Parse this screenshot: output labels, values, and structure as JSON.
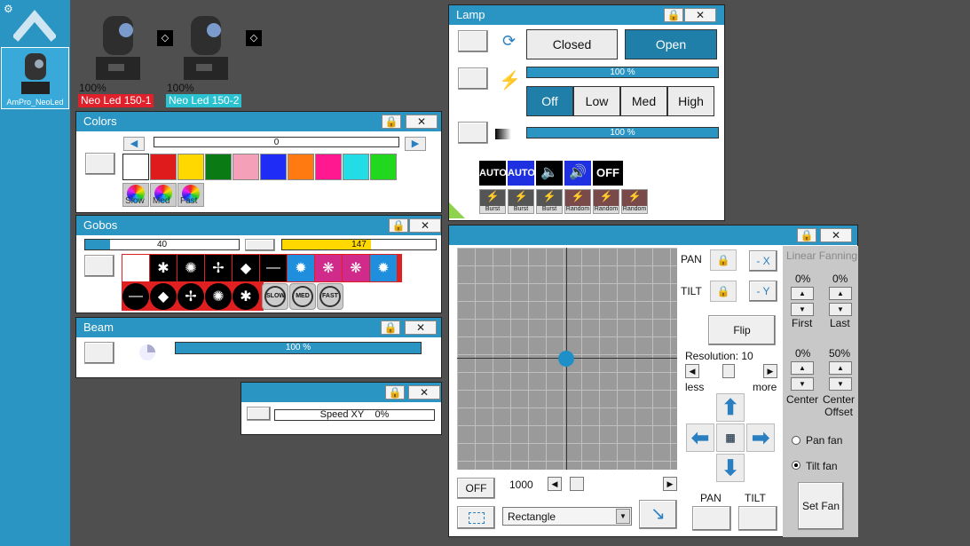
{
  "sidebar": {
    "item_label": "AmPro_NeoLed"
  },
  "fixtures": [
    {
      "pct": "100%",
      "name": "Neo Led 150-1",
      "color": "#e0202a"
    },
    {
      "pct": "100%",
      "name": "Neo Led 150-2",
      "color": "#2ac2d0"
    }
  ],
  "colors": {
    "title": "Colors",
    "value": "0",
    "palette": [
      "#ffffff",
      "#e01b1b",
      "#ffd800",
      "#0a7a14",
      "#f4a0b8",
      "#1f2cf5",
      "#ff7a10",
      "#ff1890",
      "#22dde6",
      "#22d81e"
    ],
    "speeds": [
      "Slow",
      "Med",
      "Fast"
    ]
  },
  "gobos": {
    "title": "Gobos",
    "value1": "40",
    "value2": "147",
    "row2_labels": [
      "SLOW",
      "MED",
      "FAST"
    ]
  },
  "beam": {
    "title": "Beam",
    "value": "100 %"
  },
  "speedxy": {
    "label": "Speed XY",
    "value": "0%"
  },
  "lamp": {
    "title": "Lamp",
    "closed": "Closed",
    "open": "Open",
    "bar1": "100 %",
    "bar2": "100 %",
    "levels": [
      "Off",
      "Low",
      "Med",
      "High"
    ],
    "auto1": "AUTO",
    "auto2": "AUTO",
    "off": "OFF",
    "bursts": [
      "Burst",
      "Burst",
      "Burst",
      "Random",
      "Random",
      "Random"
    ]
  },
  "pt": {
    "pan": "PAN",
    "tilt": "TILT",
    "invx": "- X",
    "invy": "- Y",
    "flip": "Flip",
    "resolution": "Resolution: 10",
    "less": "less",
    "more": "more",
    "off": "OFF",
    "speed": "1000",
    "shape": "Rectangle",
    "pan_bottom": "PAN",
    "tilt_bottom": "TILT"
  },
  "fanning": {
    "title": "Linear Fanning",
    "first_pct": "0%",
    "last_pct": "0%",
    "first": "First",
    "last": "Last",
    "center_pct": "0%",
    "offset_pct": "50%",
    "center": "Center",
    "center_offset": "Center\nOffset",
    "pan_fan": "Pan fan",
    "tilt_fan": "Tilt fan",
    "set_fan": "Set Fan"
  }
}
